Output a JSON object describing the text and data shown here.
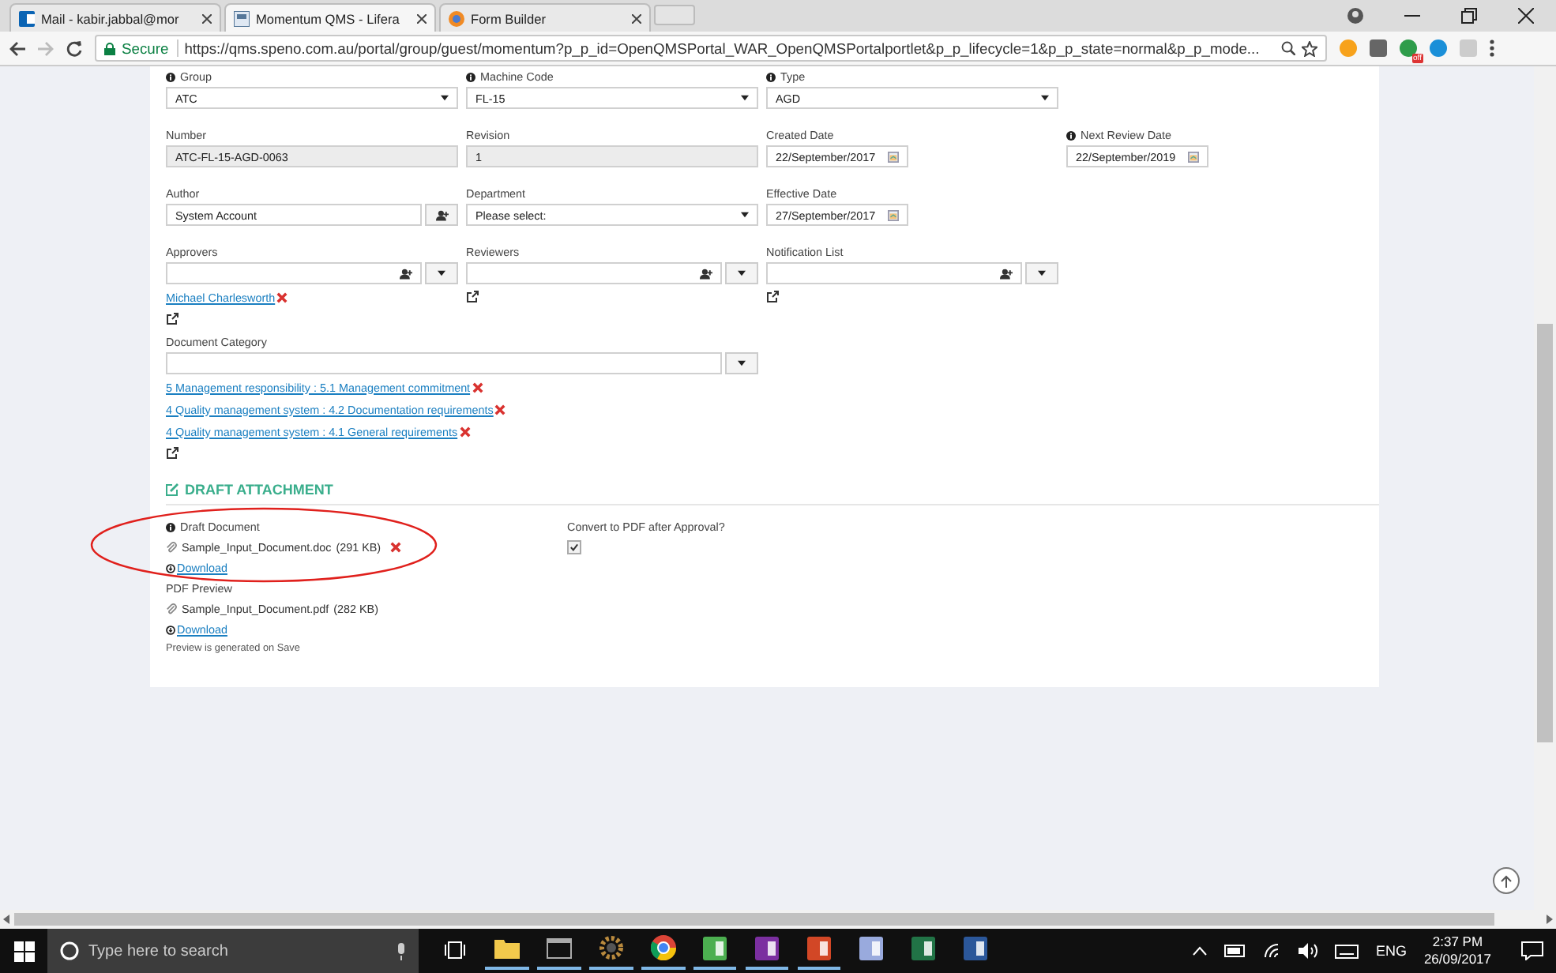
{
  "browser": {
    "tabs": [
      {
        "title": "Mail - kabir.jabbal@mor",
        "selected": false,
        "kind": "mail"
      },
      {
        "title": "Momentum QMS - Lifera",
        "selected": true,
        "kind": "portal"
      },
      {
        "title": "Form Builder",
        "selected": false,
        "kind": "builder"
      }
    ],
    "secure_label": "Secure",
    "url": "https://qms.speno.com.au/portal/group/guest/momentum?p_p_id=OpenQMSPortal_WAR_OpenQMSPortalportlet&p_p_lifecycle=1&p_p_state=normal&p_p_mode...",
    "extension_badge": "off"
  },
  "form": {
    "rows": [
      [
        {
          "label": "Group",
          "info": true,
          "kind": "select",
          "value": "ATC"
        },
        {
          "label": "Machine Code",
          "info": true,
          "kind": "select",
          "value": "FL-15"
        },
        {
          "label": "Type",
          "info": true,
          "kind": "select",
          "value": "AGD"
        }
      ],
      [
        {
          "label": "Number",
          "info": false,
          "kind": "readonly",
          "value": "ATC-FL-15-AGD-0063"
        },
        {
          "label": "Revision",
          "info": false,
          "kind": "readonly",
          "value": "1"
        },
        {
          "label": "Created Date",
          "info": false,
          "kind": "date",
          "value": "22/September/2017"
        },
        {
          "label": "Next Review Date",
          "info": true,
          "kind": "date",
          "value": "22/September/2019"
        }
      ],
      [
        {
          "label": "Author",
          "info": false,
          "kind": "picker",
          "value": "System Account"
        },
        {
          "label": "Department",
          "info": false,
          "kind": "select",
          "value": "Please select:"
        },
        {
          "label": "Effective Date",
          "info": false,
          "kind": "date",
          "value": "27/September/2017"
        }
      ],
      [
        {
          "label": "Approvers",
          "info": false,
          "kind": "multi",
          "links": [
            "Michael Charlesworth"
          ]
        },
        {
          "label": "Reviewers",
          "info": false,
          "kind": "multi"
        },
        {
          "label": "Notification List",
          "info": false,
          "kind": "multi"
        }
      ]
    ],
    "category": {
      "label": "Document Category",
      "links": [
        "5 Management responsibility : 5.1 Management commitment",
        "4 Quality management system : 4.2 Documentation requirements",
        "4 Quality management system : 4.1 General requirements"
      ]
    }
  },
  "attachment": {
    "title": "DRAFT ATTACHMENT",
    "draft": {
      "label": "Draft Document",
      "info": true,
      "file": "Sample_Input_Document.doc",
      "size": "(291 KB)",
      "removable": true,
      "download": "Download"
    },
    "convert": {
      "label": "Convert to PDF after Approval?",
      "checked": true
    },
    "preview": {
      "label": "PDF Preview",
      "file": "Sample_Input_Document.pdf",
      "size": "(282 KB)",
      "removable": false,
      "download": "Download",
      "note": "Preview is generated on Save"
    }
  },
  "taskbar": {
    "search_placeholder": "Type here to search",
    "apps": [
      {
        "kind": "folder",
        "running": true
      },
      {
        "kind": "terminal",
        "running": true
      },
      {
        "kind": "gear",
        "running": true
      },
      {
        "kind": "browser",
        "running": true
      },
      {
        "kind": "green",
        "running": true
      },
      {
        "kind": "purple",
        "running": true
      },
      {
        "kind": "orange",
        "running": true
      },
      {
        "kind": "palette",
        "running": false
      },
      {
        "kind": "sheet",
        "running": false
      },
      {
        "kind": "doc",
        "running": false
      }
    ],
    "language": "ENG",
    "time": "2:37 PM",
    "date": "26/09/2017"
  }
}
